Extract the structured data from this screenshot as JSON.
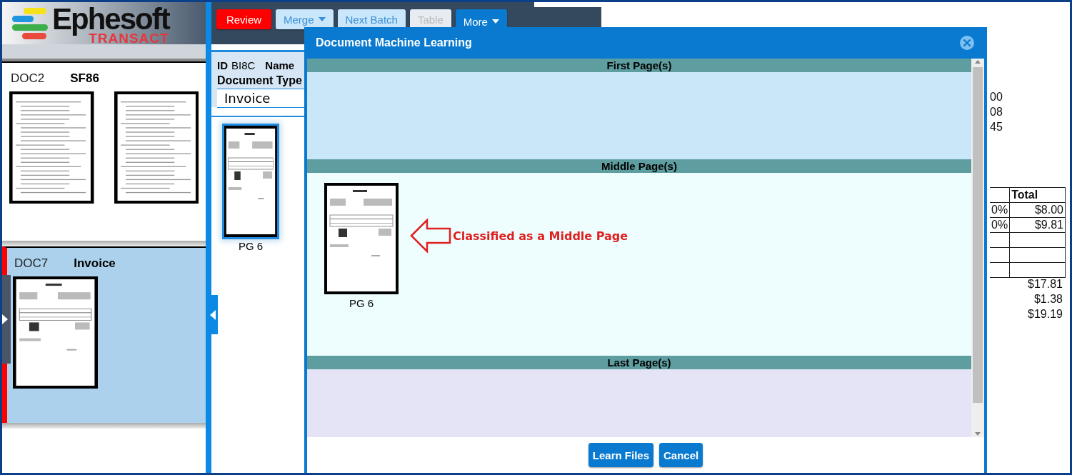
{
  "logo": {
    "name": "Ephesoft",
    "product": "TRANSACT"
  },
  "documents": [
    {
      "id": "DOC2",
      "type": "SF86",
      "selected": false,
      "thumbnails": [
        {
          "kind": "form"
        },
        {
          "kind": "form"
        }
      ]
    },
    {
      "id": "DOC7",
      "type": "Invoice",
      "selected": true,
      "thumbnails": [
        {
          "kind": "invoice"
        }
      ]
    }
  ],
  "toolbar": [
    {
      "label": "Review",
      "kind": "alert",
      "disabled": false
    },
    {
      "label": "Merge",
      "kind": "dropdown",
      "disabled": false
    },
    {
      "label": "Next Batch",
      "kind": "plain",
      "disabled": false
    },
    {
      "label": "Table",
      "kind": "plain",
      "disabled": true
    },
    {
      "label": "More",
      "kind": "dropdown-active",
      "disabled": false
    }
  ],
  "document_header": {
    "id_label": "ID",
    "id_value": "BI8C",
    "name_label": "Name",
    "type_label": "Document Type",
    "type_value": "Invoice"
  },
  "pages": [
    {
      "label": "PG 6",
      "selected": true,
      "kind": "invoice"
    }
  ],
  "document_view": {
    "header_lines": [
      "00",
      "08",
      "45"
    ],
    "table_heading": "Total",
    "rows": [
      [
        "0%",
        "$8.00"
      ],
      [
        "0%",
        "$9.81"
      ]
    ],
    "totals": [
      "$17.81",
      "$1.38",
      "$19.19"
    ]
  },
  "dialog": {
    "title": "Document Machine Learning",
    "sections": [
      {
        "title": "First Page(s)"
      },
      {
        "title": "Middle Page(s)",
        "pages": [
          {
            "label": "PG 6",
            "kind": "invoice"
          }
        ],
        "annotation": "Classified as a Middle Page"
      },
      {
        "title": "Last Page(s)"
      }
    ],
    "buttons": [
      "Learn Files",
      "Cancel"
    ]
  }
}
